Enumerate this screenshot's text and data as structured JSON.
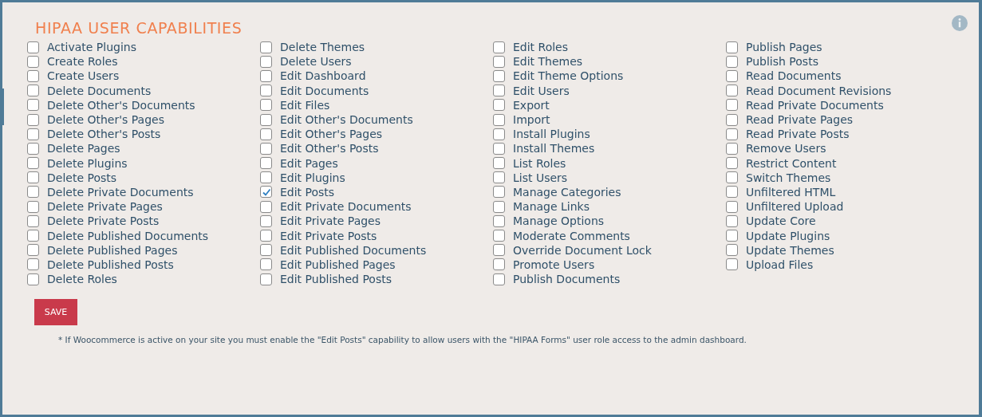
{
  "title": "HIPAA USER CAPABILITIES",
  "columns": [
    [
      {
        "label": "Activate Plugins",
        "checked": false
      },
      {
        "label": "Create Roles",
        "checked": false
      },
      {
        "label": "Create Users",
        "checked": false
      },
      {
        "label": "Delete Documents",
        "checked": false
      },
      {
        "label": "Delete Other's Documents",
        "checked": false
      },
      {
        "label": "Delete Other's Pages",
        "checked": false
      },
      {
        "label": "Delete Other's Posts",
        "checked": false
      },
      {
        "label": "Delete Pages",
        "checked": false
      },
      {
        "label": "Delete Plugins",
        "checked": false
      },
      {
        "label": "Delete Posts",
        "checked": false
      },
      {
        "label": "Delete Private Documents",
        "checked": false
      },
      {
        "label": "Delete Private Pages",
        "checked": false
      },
      {
        "label": "Delete Private Posts",
        "checked": false
      },
      {
        "label": "Delete Published Documents",
        "checked": false
      },
      {
        "label": "Delete Published Pages",
        "checked": false
      },
      {
        "label": "Delete Published Posts",
        "checked": false
      },
      {
        "label": "Delete Roles",
        "checked": false
      }
    ],
    [
      {
        "label": "Delete Themes",
        "checked": false
      },
      {
        "label": "Delete Users",
        "checked": false
      },
      {
        "label": "Edit Dashboard",
        "checked": false
      },
      {
        "label": "Edit Documents",
        "checked": false
      },
      {
        "label": "Edit Files",
        "checked": false
      },
      {
        "label": "Edit Other's Documents",
        "checked": false
      },
      {
        "label": "Edit Other's Pages",
        "checked": false
      },
      {
        "label": "Edit Other's Posts",
        "checked": false
      },
      {
        "label": "Edit Pages",
        "checked": false
      },
      {
        "label": "Edit Plugins",
        "checked": false
      },
      {
        "label": "Edit Posts",
        "checked": true
      },
      {
        "label": "Edit Private Documents",
        "checked": false
      },
      {
        "label": "Edit Private Pages",
        "checked": false
      },
      {
        "label": "Edit Private Posts",
        "checked": false
      },
      {
        "label": "Edit Published Documents",
        "checked": false
      },
      {
        "label": "Edit Published Pages",
        "checked": false
      },
      {
        "label": "Edit Published Posts",
        "checked": false
      }
    ],
    [
      {
        "label": "Edit Roles",
        "checked": false
      },
      {
        "label": "Edit Themes",
        "checked": false
      },
      {
        "label": "Edit Theme Options",
        "checked": false
      },
      {
        "label": "Edit Users",
        "checked": false
      },
      {
        "label": "Export",
        "checked": false
      },
      {
        "label": "Import",
        "checked": false
      },
      {
        "label": "Install Plugins",
        "checked": false
      },
      {
        "label": "Install Themes",
        "checked": false
      },
      {
        "label": "List Roles",
        "checked": false
      },
      {
        "label": "List Users",
        "checked": false
      },
      {
        "label": "Manage Categories",
        "checked": false
      },
      {
        "label": "Manage Links",
        "checked": false
      },
      {
        "label": "Manage Options",
        "checked": false
      },
      {
        "label": "Moderate Comments",
        "checked": false
      },
      {
        "label": "Override Document Lock",
        "checked": false
      },
      {
        "label": "Promote Users",
        "checked": false
      },
      {
        "label": "Publish Documents",
        "checked": false
      }
    ],
    [
      {
        "label": "Publish Pages",
        "checked": false
      },
      {
        "label": "Publish Posts",
        "checked": false
      },
      {
        "label": "Read Documents",
        "checked": false
      },
      {
        "label": "Read Document Revisions",
        "checked": false
      },
      {
        "label": "Read Private Documents",
        "checked": false
      },
      {
        "label": "Read Private Pages",
        "checked": false
      },
      {
        "label": "Read Private Posts",
        "checked": false
      },
      {
        "label": "Remove Users",
        "checked": false
      },
      {
        "label": "Restrict Content",
        "checked": false
      },
      {
        "label": "Switch Themes",
        "checked": false
      },
      {
        "label": "Unfiltered HTML",
        "checked": false
      },
      {
        "label": "Unfiltered Upload",
        "checked": false
      },
      {
        "label": "Update Core",
        "checked": false
      },
      {
        "label": "Update Plugins",
        "checked": false
      },
      {
        "label": "Update Themes",
        "checked": false
      },
      {
        "label": "Upload Files",
        "checked": false
      }
    ]
  ],
  "save_button": "SAVE",
  "note": "* If Woocommerce is active on your site you must enable the \"Edit Posts\" capability to allow users with the \"HIPAA Forms\" user role access to the admin dashboard."
}
